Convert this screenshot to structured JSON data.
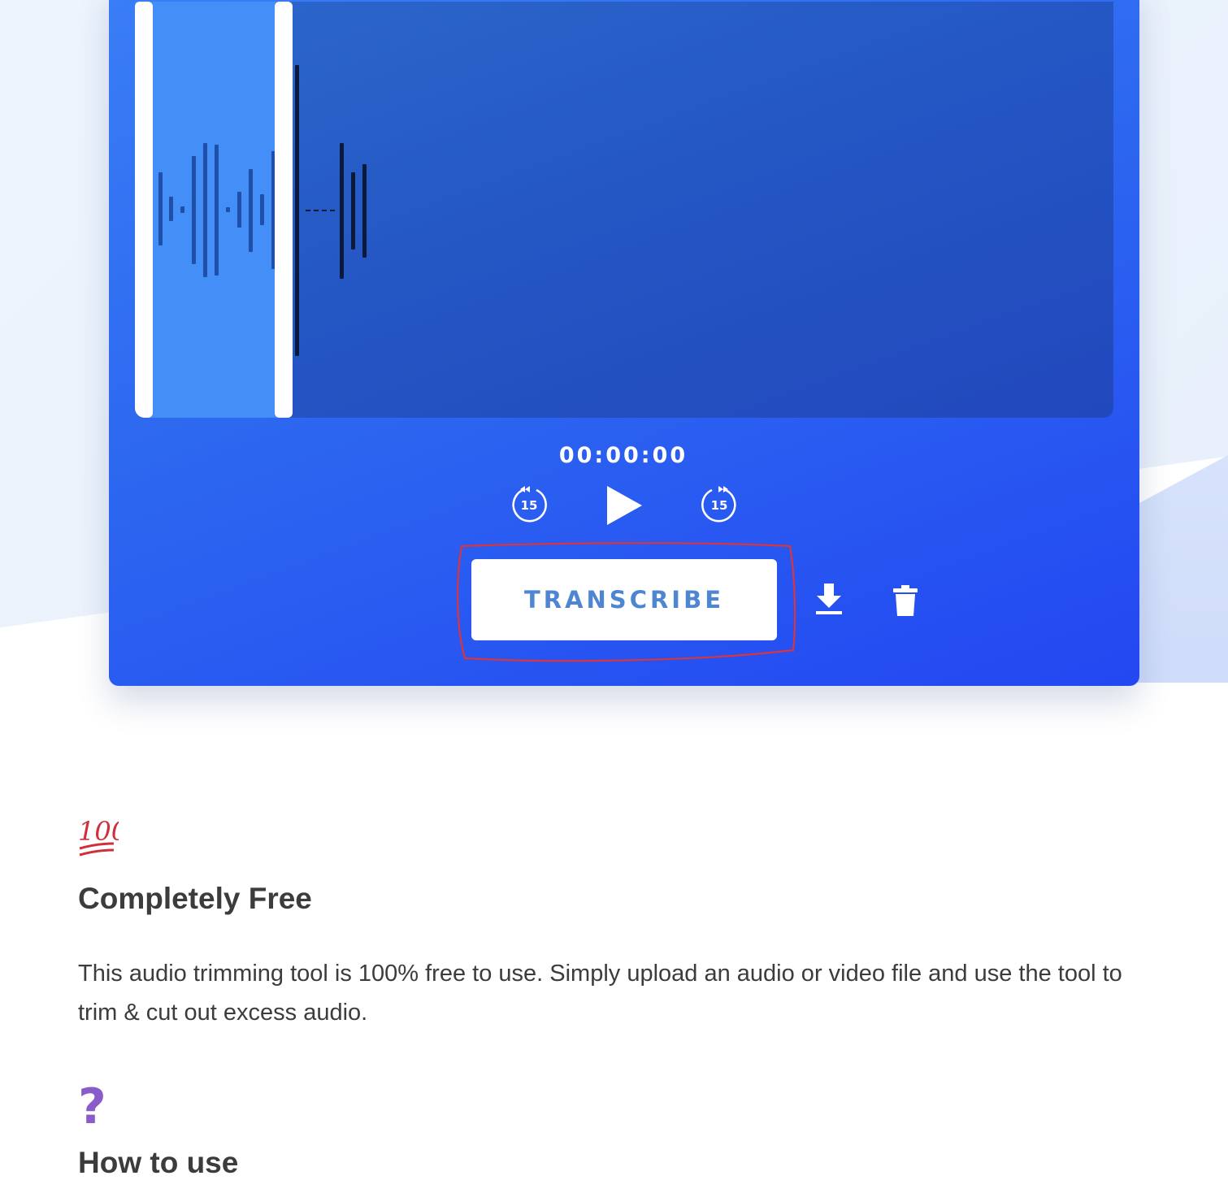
{
  "player": {
    "time": "00:00:00",
    "rewind_label": "15",
    "forward_label": "15",
    "transcribe_label": "TRANSCRIBE"
  },
  "features": [
    {
      "icon": "hundred-points-icon",
      "title": "Completely Free",
      "text": "This audio trimming tool is 100% free to use. Simply upload an audio or video file and use the tool to trim & cut out excess audio."
    },
    {
      "icon": "question-mark-icon",
      "title": "How to use"
    }
  ],
  "colors": {
    "card_start": "#3a7ef6",
    "card_end": "#2347f2",
    "selection": "#448ef7",
    "button_text": "#4f86d2",
    "annotation": "#d9353f",
    "emoji_red": "#d0303a",
    "emoji_purple": "#8a5cc9"
  }
}
